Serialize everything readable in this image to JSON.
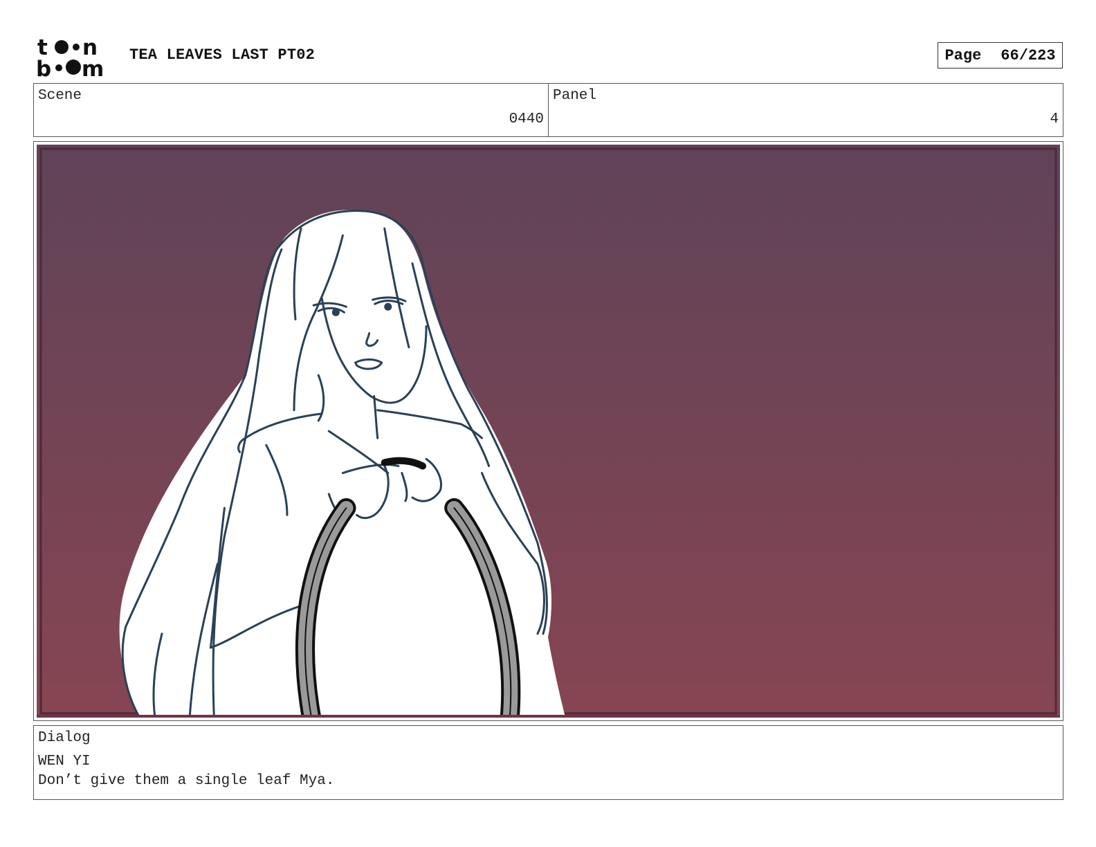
{
  "header": {
    "logo_text_top": "toon",
    "logo_text_bottom": "boom",
    "title": "TEA LEAVES LAST PT02",
    "page_label": "Page",
    "page_value": "66/223"
  },
  "info": {
    "scene_label": "Scene",
    "scene_value": "0440",
    "panel_label": "Panel",
    "panel_value": "4"
  },
  "panel_image": {
    "background_top_color": "#5f4358",
    "background_bottom_color": "#874552",
    "line_color": "#2a4157"
  },
  "dialog": {
    "label": "Dialog",
    "speaker": "WEN YI",
    "line": "Don’t give them a single leaf Mya."
  }
}
